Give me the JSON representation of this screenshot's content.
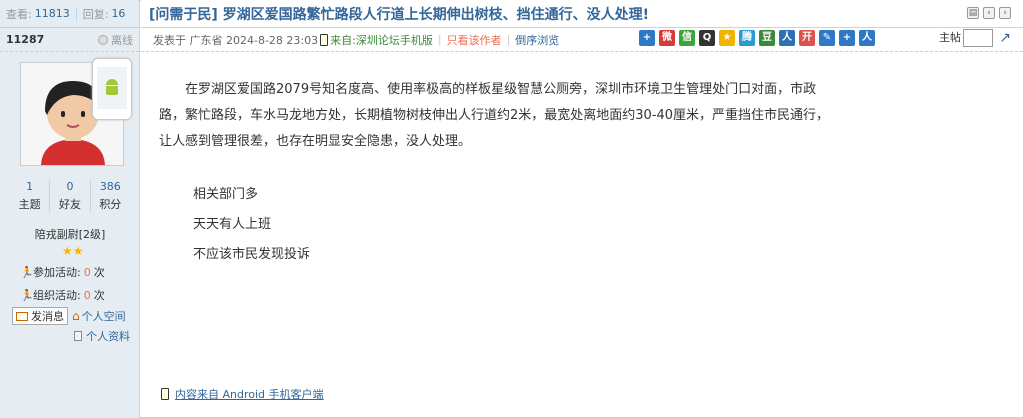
{
  "stats": {
    "views_label": "查看:",
    "views": "11813",
    "replies_label": "回复:",
    "replies": "16"
  },
  "author": {
    "uid": "11287",
    "status": "离线"
  },
  "profile": {
    "counts": [
      {
        "value": "1",
        "label": "主题"
      },
      {
        "value": "0",
        "label": "好友"
      },
      {
        "value": "386",
        "label": "积分"
      }
    ],
    "rank": "陪戎副尉[2级]",
    "stars": 2,
    "activities": [
      {
        "label": "参加活动:",
        "value": "0",
        "unit": "次"
      },
      {
        "label": "组织活动:",
        "value": "0",
        "unit": "次"
      }
    ],
    "send_message": "发消息",
    "personal_space": "个人空间",
    "personal_profile": "个人资料"
  },
  "post": {
    "title": "[问需于民] 罗湖区爱国路繁忙路段人行道上长期伸出树枝、挡住通行、没人处理!",
    "posted_at": "发表于 广东省 2024-8-28 23:03",
    "via_label": "来自:",
    "via_source": "深圳论坛手机版",
    "only_author": "只看该作者",
    "reverse_browse": "倒序浏览",
    "floor_label": "主帖",
    "paragraph": "在罗湖区爱国路2079号知名度高、使用率极高的样板星级智慧公厕旁，深圳市环境卫生管理处门口对面，市政路，繁忙路段，车水马龙地方处，长期植物树枝伸出人行道约2米，最宽处离地面约30-40厘米，严重挡住市民通行，让人感到管理很差，也存在明显安全隐患，没人处理。",
    "lines": [
      "相关部门多",
      "天天有人上班",
      "不应该市民发现投诉"
    ],
    "footer": "内容来自 Android 手机客户端"
  },
  "share_icons": [
    {
      "name": "plus-icon",
      "color": "#2f78c6",
      "glyph": "+"
    },
    {
      "name": "sina-weibo-icon",
      "color": "#d63b3b",
      "glyph": "微"
    },
    {
      "name": "wechat-icon",
      "color": "#3aa53a",
      "glyph": "信"
    },
    {
      "name": "qq-icon",
      "color": "#333333",
      "glyph": "Q"
    },
    {
      "name": "qzone-icon",
      "color": "#f0b400",
      "glyph": "★"
    },
    {
      "name": "tencent-weibo-icon",
      "color": "#2a9bd4",
      "glyph": "腾"
    },
    {
      "name": "douban-icon",
      "color": "#3a8a3a",
      "glyph": "豆"
    },
    {
      "name": "renren-icon",
      "color": "#2f6fb5",
      "glyph": "人"
    },
    {
      "name": "kaixin-icon",
      "color": "#d9534f",
      "glyph": "开"
    },
    {
      "name": "pen-icon",
      "color": "#2f78c6",
      "glyph": "✎"
    },
    {
      "name": "add-icon",
      "color": "#2f78c6",
      "glyph": "+"
    },
    {
      "name": "person-icon",
      "color": "#2f78c6",
      "glyph": "人"
    }
  ]
}
